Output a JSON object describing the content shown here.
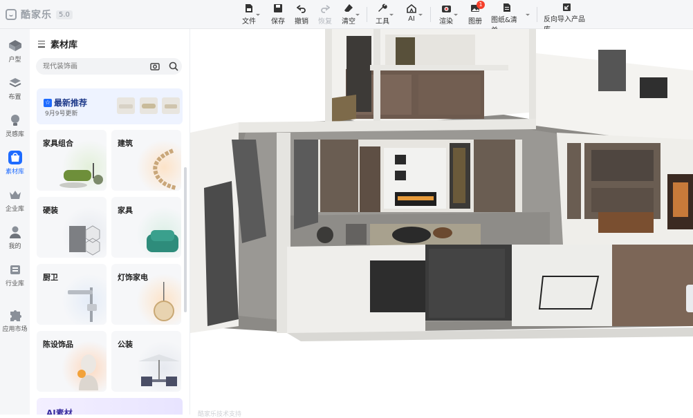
{
  "app": {
    "name": "酷家乐",
    "version": "5.0"
  },
  "toolbar": {
    "file": "文件",
    "save": "保存",
    "undo": "撤销",
    "redo": "恢复",
    "clear": "清空",
    "tools": "工具",
    "ai": "AI",
    "render": "渲染",
    "album": "图册",
    "album_badge": "1",
    "drawings": "图纸&清单",
    "reverse_import": "反向导入产品库"
  },
  "nav": {
    "items": [
      {
        "label": "户型",
        "icon": "floorplan-icon"
      },
      {
        "label": "布置",
        "icon": "layout-icon"
      },
      {
        "label": "灵感库",
        "icon": "lightbulb-icon"
      },
      {
        "label": "素材库",
        "icon": "material-icon"
      },
      {
        "label": "企业库",
        "icon": "crown-icon"
      },
      {
        "label": "我的",
        "icon": "user-icon"
      },
      {
        "label": "行业库",
        "icon": "industry-icon"
      },
      {
        "label": "应用市场",
        "icon": "puzzle-icon"
      }
    ],
    "active_index": 3
  },
  "panel": {
    "title": "素材库",
    "search_placeholder": "现代装饰画",
    "recommend": {
      "title": "最新推荐",
      "subtitle": "9月9号更新"
    },
    "categories": [
      {
        "label": "家具组合"
      },
      {
        "label": "建筑"
      },
      {
        "label": "硬装"
      },
      {
        "label": "家具"
      },
      {
        "label": "厨卫"
      },
      {
        "label": "灯饰家电"
      },
      {
        "label": "陈设饰品"
      },
      {
        "label": "公装"
      }
    ],
    "ai_card": "AI素材"
  },
  "footer": {
    "watermark": "酷家乐技术支持"
  },
  "colors": {
    "accent": "#1e6bff",
    "badge": "#f5402c"
  }
}
